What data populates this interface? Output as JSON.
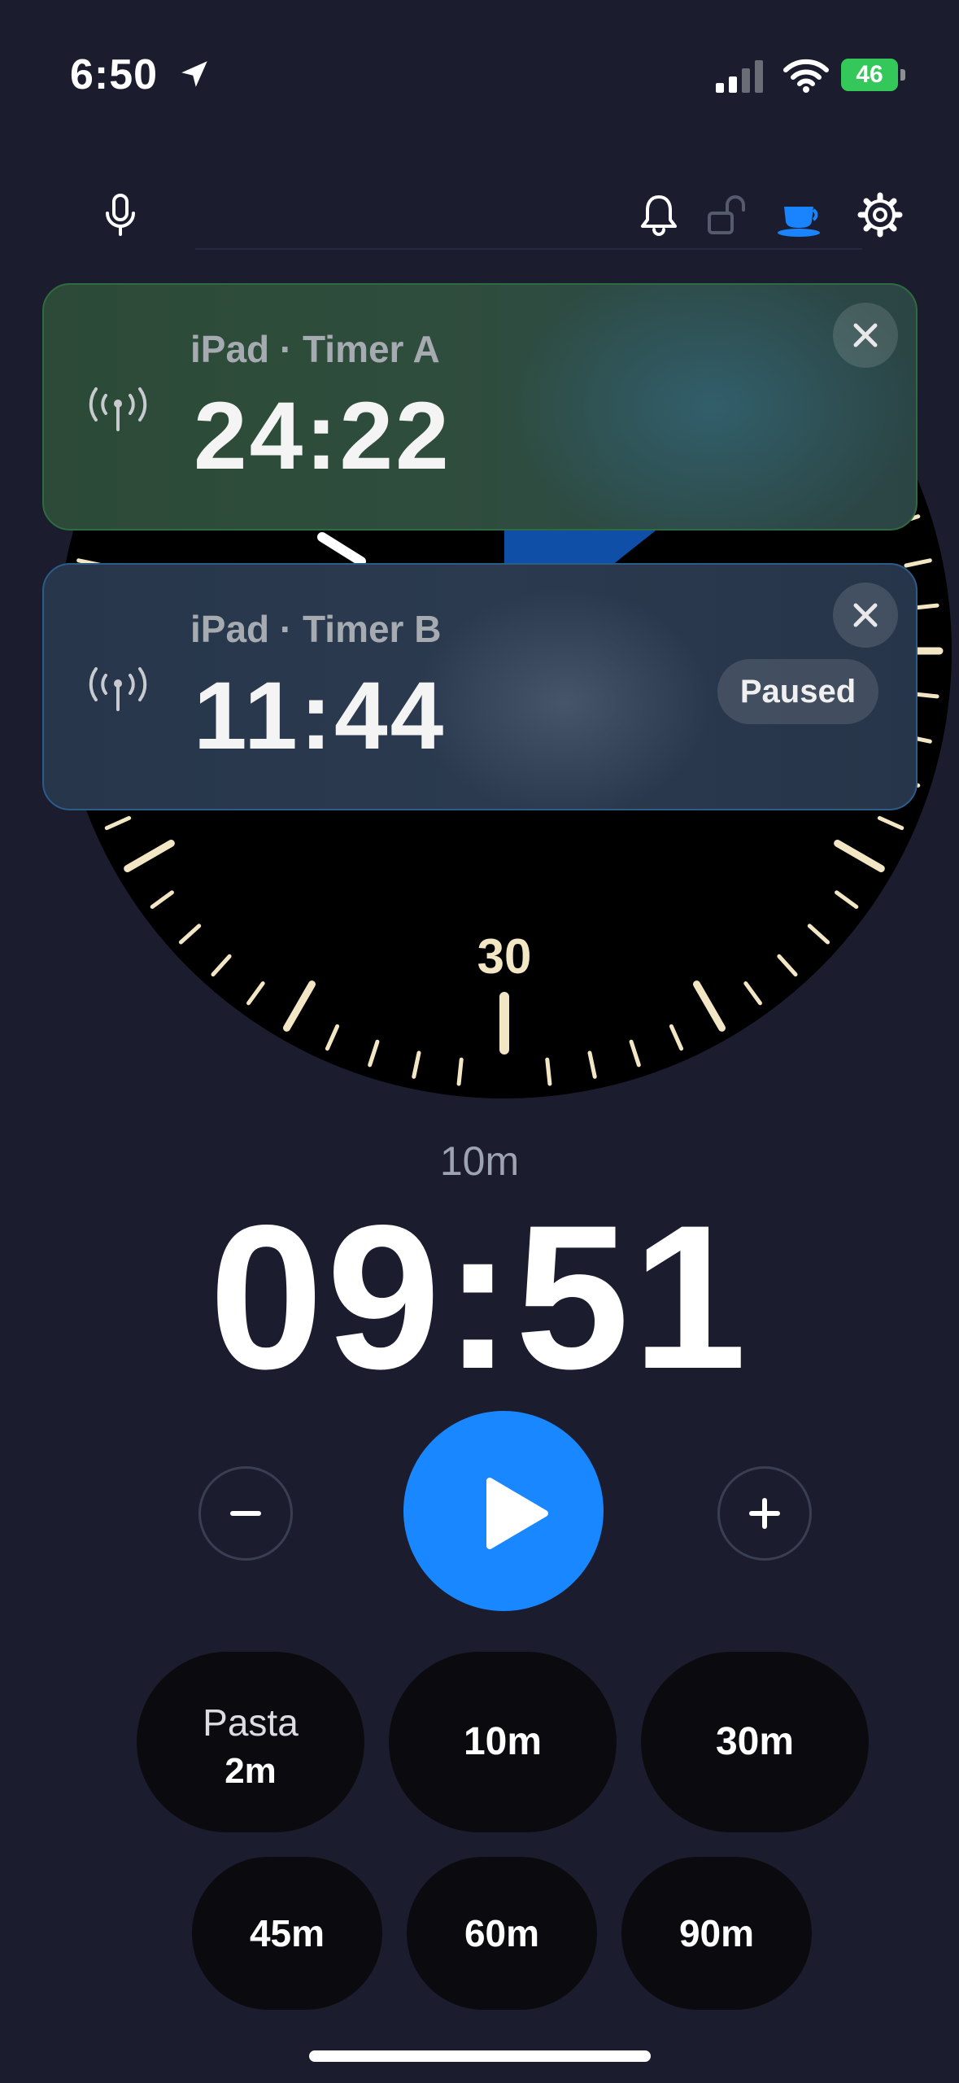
{
  "status_bar": {
    "time": "6:50",
    "battery_level": "46",
    "icons": [
      "location-arrow-icon",
      "cellular-signal-icon",
      "wifi-icon",
      "battery-charging-icon"
    ]
  },
  "toolbar": {
    "icons": [
      "microphone-icon",
      "bell-icon",
      "unlock-icon",
      "coffee-cup-icon",
      "gear-icon"
    ],
    "active_color": "#1a84ff"
  },
  "dial": {
    "label": "30",
    "tick_color": "#f3e6c4"
  },
  "live_timers": [
    {
      "title": "iPad · Timer A",
      "time": "24:22",
      "status": "",
      "icon": "antenna-icon",
      "accent": "#2f6b41"
    },
    {
      "title": "iPad · Timer B",
      "time": "11:44",
      "status": "Paused",
      "icon": "antenna-icon",
      "accent": "#2b5d88"
    }
  ],
  "timer": {
    "preset_label": "10m",
    "time": "09:51"
  },
  "controls": {
    "minus_icon": "minus-icon",
    "play_icon": "play-icon",
    "plus_icon": "plus-icon",
    "play_color": "#1987ff"
  },
  "presets": [
    {
      "name": "Pasta",
      "time": "2m"
    },
    {
      "time": "10m"
    },
    {
      "time": "30m"
    },
    {
      "time": "45m"
    },
    {
      "time": "60m"
    },
    {
      "time": "90m"
    }
  ]
}
